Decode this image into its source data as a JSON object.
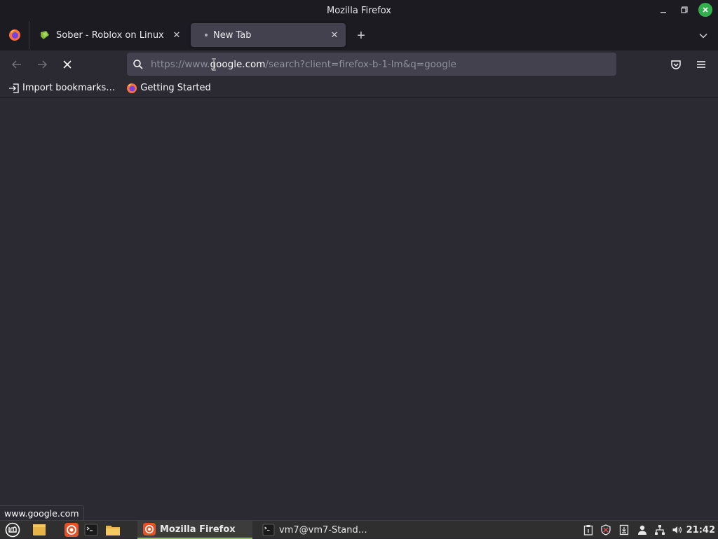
{
  "window": {
    "title": "Mozilla Firefox",
    "minimize_icon": "minimize-icon",
    "maximize_icon": "maximize-icon",
    "close_icon": "close-icon"
  },
  "tabs": [
    {
      "label": "Sober - Roblox on Linux",
      "favicon": "sober-icon",
      "active": false,
      "close": "✕"
    },
    {
      "label": "New Tab",
      "favicon": "loading-dot",
      "active": true,
      "close": "✕"
    }
  ],
  "tabstrip": {
    "new_tab": "+",
    "list_all_tabs_icon": "chevron-down-icon"
  },
  "nav": {
    "back_icon": "arrow-left-icon",
    "forward_icon": "arrow-right-icon",
    "stop_icon": "stop-icon",
    "url_prefix": "https://www.",
    "url_host": "google.com",
    "url_rest": "/search?client=firefox-b-1-lm&q=google",
    "pocket_icon": "pocket-icon",
    "menu_icon": "hamburger-icon"
  },
  "bookmarks": [
    {
      "label": "Import bookmarks…",
      "icon": "import-icon"
    },
    {
      "label": "Getting Started",
      "icon": "firefox-icon"
    }
  ],
  "status": {
    "text": "www.google.com"
  },
  "taskbar": {
    "tasks": [
      {
        "label": "Mozilla Firefox",
        "icon": "firefox-icon",
        "active": true
      },
      {
        "label": "vm7@vm7-Stand…",
        "icon": "terminal-icon",
        "active": false
      }
    ],
    "clock": "21:42"
  },
  "colors": {
    "chrome_dark": "#1c1b22",
    "toolbar": "#2b2a33",
    "field": "#42414d",
    "mint_green": "#8fbd4e",
    "close_green": "#33b04d"
  }
}
